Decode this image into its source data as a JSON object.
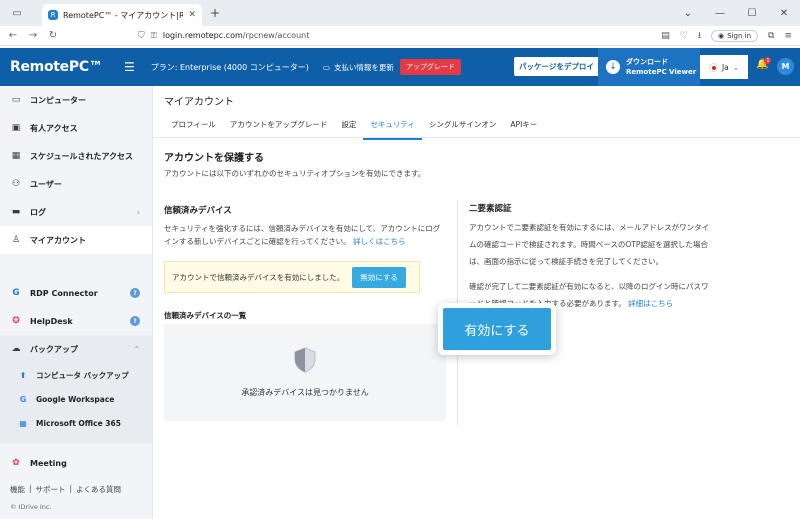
{
  "browser": {
    "tab_title": "RemotePC™ - マイアカウント|R",
    "url_host": "login.remotepc.com",
    "url_path": "/rpcnew/account",
    "signin_label": "Sign in"
  },
  "topbar": {
    "logo": "RemotePC™",
    "plan": "プラン: Enterprise (4000 コンピューター)",
    "renew": "支払い情報を更新",
    "upgrade": "アップグレード",
    "deploy": "パッケージをデプロイ",
    "download_line1": "ダウンロード",
    "download_line2": "RemotePC Viewer",
    "lang": "Ja",
    "notif_count": "1",
    "avatar": "M"
  },
  "sidebar": {
    "items": [
      {
        "label": "コンピューター"
      },
      {
        "label": "有人アクセス"
      },
      {
        "label": "スケジュールされたアクセス"
      },
      {
        "label": "ユーザー"
      },
      {
        "label": "ログ"
      },
      {
        "label": "マイアカウント"
      },
      {
        "label": "RDP Connector"
      },
      {
        "label": "HelpDesk"
      },
      {
        "label": "バックアップ"
      },
      {
        "label": "コンピュータ バックアップ"
      },
      {
        "label": "Google Workspace"
      },
      {
        "label": "Microsoft Office 365"
      },
      {
        "label": "Meeting"
      }
    ],
    "footer": [
      "機能",
      "サポート",
      "よくある質問"
    ],
    "copyright": "© IDrive Inc."
  },
  "main": {
    "title": "マイアカウント",
    "tabs": [
      "プロフィール",
      "アカウントをアップグレード",
      "設定",
      "セキュリティ",
      "シングルサインオン",
      "APIキー"
    ],
    "heading": "アカウントを保護する",
    "desc": "アカウントには以下のいずれかのセキュリティオプションを有効にできます。",
    "trusted": {
      "title": "信頼済みデバイス",
      "desc": "セキュリティを強化するには、信頼済みデバイスを有効にして、アカウントにログインする新しいデバイスごとに確認を行ってください。",
      "link": "詳しくはこちら",
      "notice": "アカウントで信頼済みデバイスを有効にしました。",
      "disable_btn": "無効にする",
      "list_title": "信頼済みデバイスの一覧",
      "empty": "承認済みデバイスは見つかりません"
    },
    "tfa": {
      "title": "二要素認証",
      "p1": "アカウントで二要素認証を有効にするには、メールアドレスがワンタイムの確認コードで検証されます。時間ベースのOTP認証を選択した場合は、画面の指示に従って検証手続きを完了してください。",
      "p2": "確認が完了して二要素認証が有効になると、以降のログイン時にパスワードと確認コードを入力する必要があります。",
      "link": "詳細はこちら",
      "enable_btn": "有効にする"
    }
  }
}
